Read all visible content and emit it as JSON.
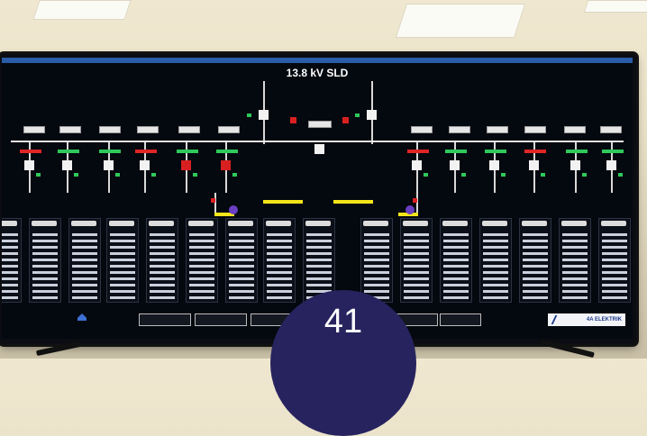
{
  "screen": {
    "title": "13.8 kV SLD",
    "nav_buttons": [
      "",
      "",
      "",
      "",
      ""
    ],
    "logo_text": "4A ELEKTRIK"
  },
  "overlay_badge": {
    "number": "41"
  },
  "colors": {
    "background": "#04080f",
    "busbar": "#e6e6e6",
    "energized_green": "#2fc95a",
    "alarm_red": "#e02525",
    "coupling_yellow": "#f3e51a",
    "badge": "#27235f"
  },
  "icons": [
    "breaker-icon",
    "transformer-icon",
    "logo-icon"
  ]
}
